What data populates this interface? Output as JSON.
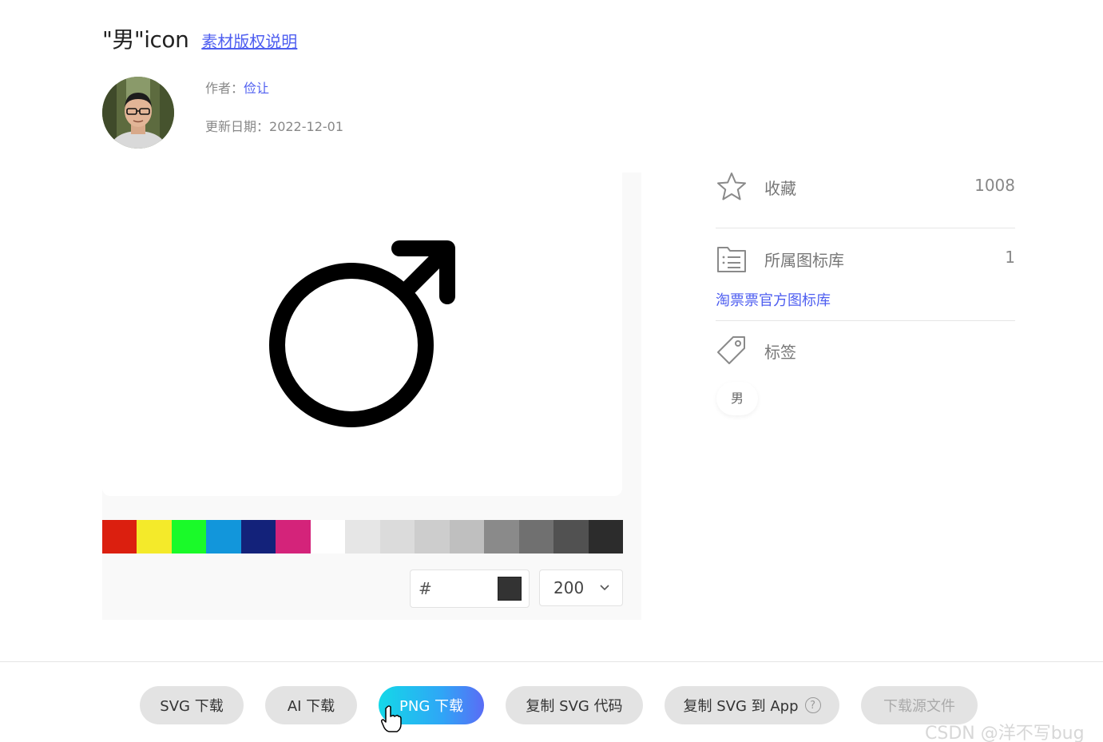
{
  "header": {
    "title": "\"男\"icon",
    "license_link": "素材版权说明"
  },
  "author": {
    "label": "作者：",
    "name": "俭让",
    "date_label": "更新日期：",
    "date": "2022-12-01"
  },
  "preview": {
    "icon": "male-symbol-icon",
    "icon_color": "#000000"
  },
  "palette": [
    "#db1f0f",
    "#f4ea2a",
    "#1afa29",
    "#1296db",
    "#13227a",
    "#d4237a",
    "#ffffff",
    "#e6e6e6",
    "#dbdbdb",
    "#cdcdcd",
    "#bfbfbf",
    "#8a8a8a",
    "#707070",
    "#515151",
    "#2c2c2c"
  ],
  "color_input": {
    "hash": "#",
    "value": "",
    "swatch": "#333333"
  },
  "size_select": {
    "value": "200"
  },
  "sidebar": {
    "favorite": {
      "label": "收藏",
      "count": "1008",
      "icon": "star-icon"
    },
    "library": {
      "label": "所属图标库",
      "count": "1",
      "icon": "list-icon",
      "link": "淘票票官方图标库"
    },
    "tags": {
      "label": "标签",
      "icon": "tag-icon",
      "items": [
        "男"
      ]
    }
  },
  "actions": {
    "svg_download": "SVG 下载",
    "ai_download": "AI 下载",
    "png_download": "PNG 下载",
    "copy_svg_code": "复制 SVG 代码",
    "copy_svg_app": "复制 SVG 到 App",
    "help": "?",
    "source_download": "下载源文件"
  },
  "watermark": "CSDN @洋不写bug"
}
